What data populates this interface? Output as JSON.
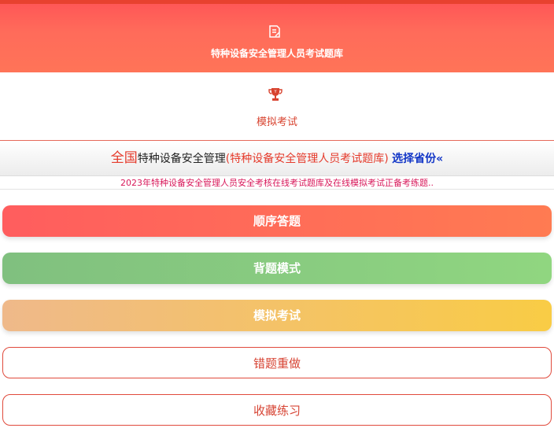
{
  "header": {
    "title": "特种设备安全管理人员考试题库",
    "icon": "edit-note-icon"
  },
  "mock": {
    "label": "模拟考试",
    "icon": "trophy-icon"
  },
  "province_bar": {
    "region": "全国",
    "category": "特种设备安全管理",
    "bank": "(特种设备安全管理人员考试题库)",
    "choose": "选择省份«"
  },
  "notice": "2023年特种设备安全管理人员安全考核在线考试题库及在线模拟考试正备考练题..",
  "buttons": {
    "sequential": "顺序答题",
    "memorize": "背题模式",
    "mock_exam": "模拟考试",
    "wrong_redo": "错题重做",
    "favorites": "收藏练习"
  },
  "colors": {
    "accent": "#ff5d5e",
    "link": "#1236c7",
    "notice": "#d8185a"
  }
}
